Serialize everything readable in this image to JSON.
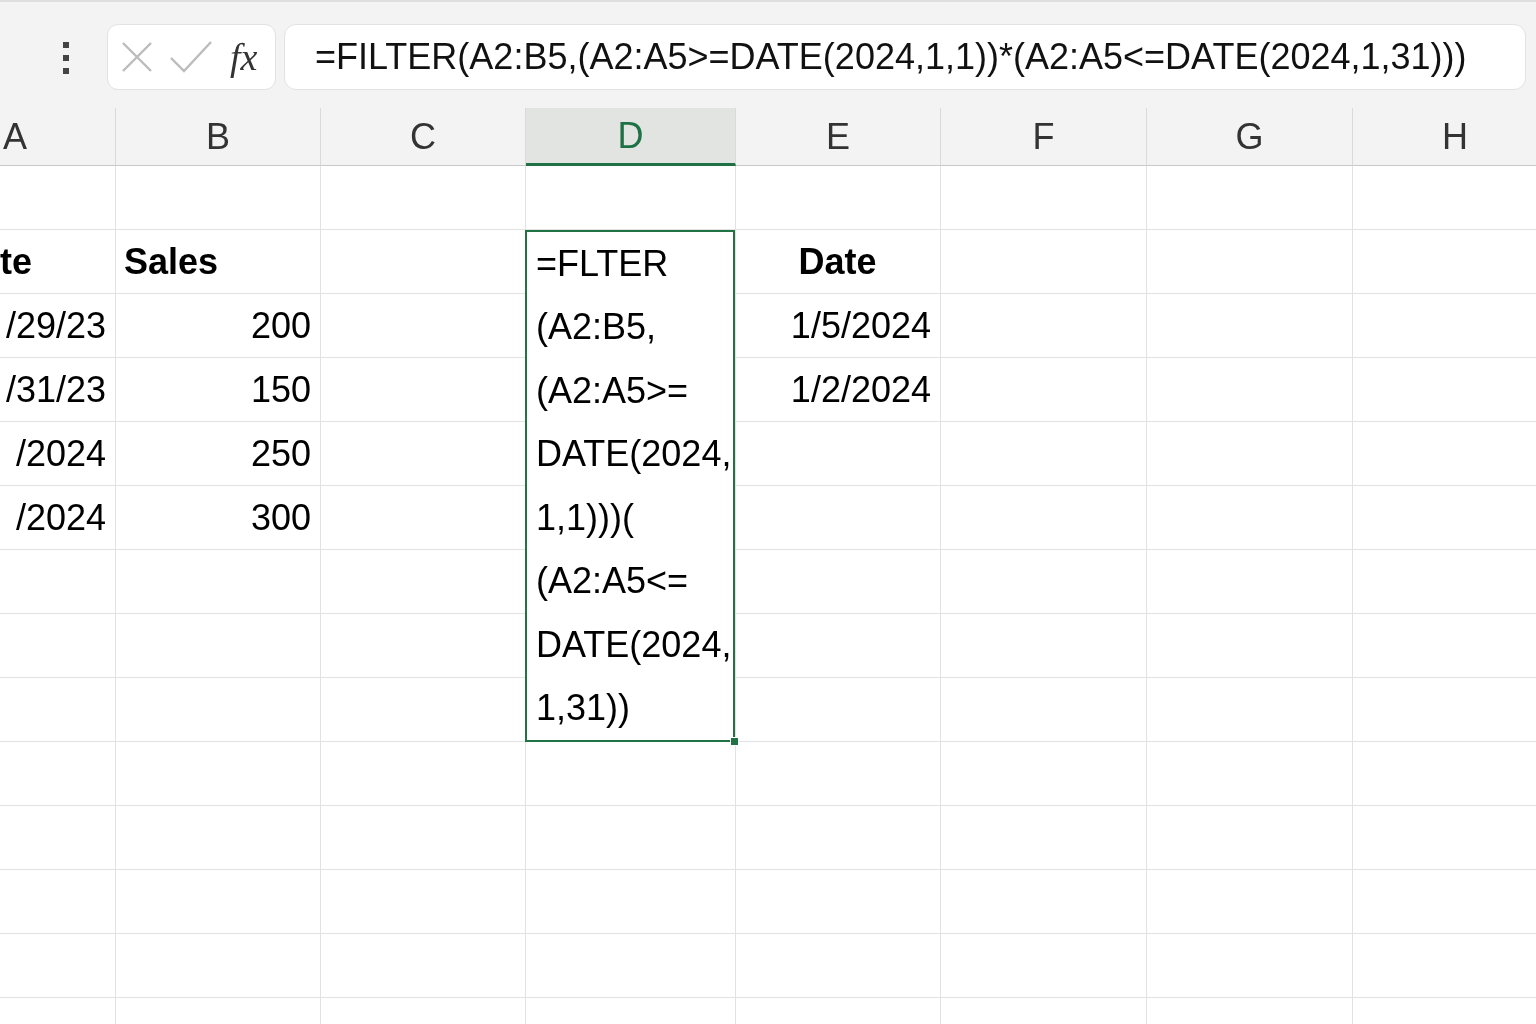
{
  "formula_bar": {
    "function_label": "fx",
    "formula": "=FILTER(A2:B5,(A2:A5>=DATE(2024,1,1))*(A2:A5<=DATE(2024,1,31)))"
  },
  "sheet": {
    "columns": [
      {
        "label": "A",
        "selected": false,
        "cells": [
          {
            "kind": "heading",
            "text": "te"
          },
          {
            "kind": "value",
            "text": "/29/23"
          },
          {
            "kind": "value",
            "text": "/31/23"
          },
          {
            "kind": "value",
            "text": "/2024"
          },
          {
            "kind": "value",
            "text": "/2024"
          }
        ]
      },
      {
        "label": "B",
        "selected": false,
        "cells": [
          {
            "kind": "heading",
            "text": "Sales"
          },
          {
            "kind": "value",
            "text": "200"
          },
          {
            "kind": "value",
            "text": "150"
          },
          {
            "kind": "value",
            "text": "250"
          },
          {
            "kind": "value",
            "text": "300"
          }
        ]
      },
      {
        "label": "C",
        "selected": false
      },
      {
        "label": "D",
        "selected": true,
        "cells": [
          {
            "kind": "formula",
            "selected": true,
            "lines": [
              "=FLTER",
              "(A2:B5,",
              "(A2:A5>=",
              "DATE(2024,",
              "1,1)))(",
              "(A2:A5<=",
              "DATE(2024,",
              "1,31))"
            ]
          }
        ]
      },
      {
        "label": "E",
        "selected": false,
        "cells": [
          {
            "kind": "centered_heading",
            "text": "Date"
          },
          {
            "kind": "value",
            "text": "1/5/2024"
          },
          {
            "kind": "value",
            "text": "1/2/2024"
          }
        ]
      },
      {
        "label": "F",
        "selected": false
      },
      {
        "label": "G",
        "selected": false
      },
      {
        "label": "H",
        "selected": false
      }
    ]
  }
}
